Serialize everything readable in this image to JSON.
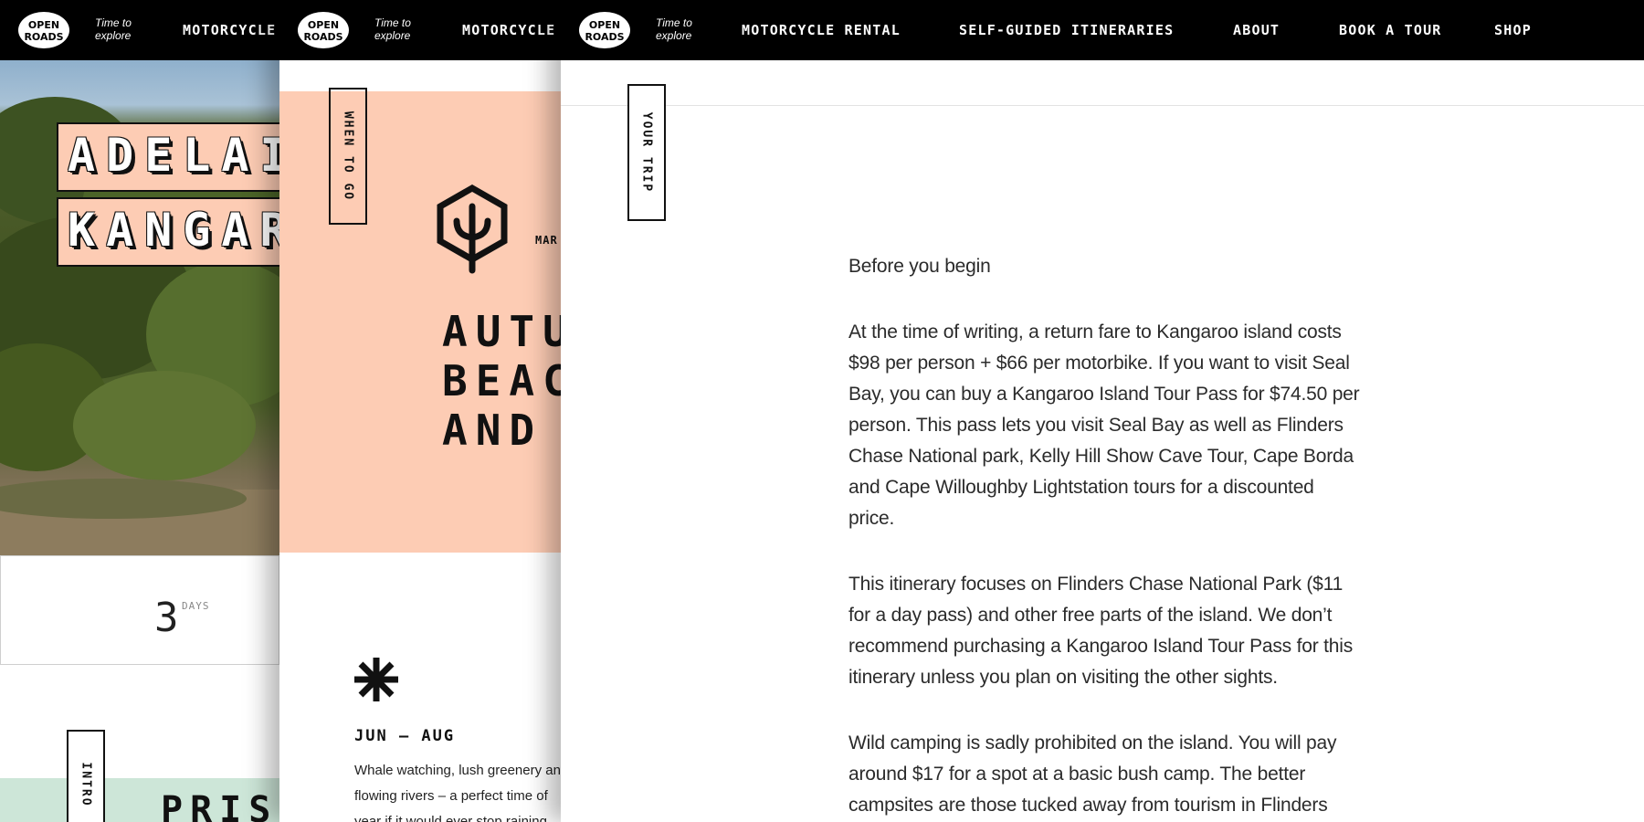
{
  "brand": {
    "logo_text": "OPEN ROADS",
    "tagline": "Time to explore"
  },
  "nav": {
    "truncated_item": "MOTORCYCLE",
    "items": [
      "MOTORCYCLE RENTAL",
      "SELF-GUIDED ITINERARIES",
      "ABOUT",
      "BOOK A TOUR",
      "SHOP"
    ]
  },
  "panel1": {
    "title_line_1": "ADELAI",
    "title_line_2": "KANGAR",
    "days_value": "3",
    "days_unit": "DAYS",
    "section_tab": "INTRO",
    "section_heading": "PRIST"
  },
  "panel2": {
    "section_tab": "WHEN TO GO",
    "months_label": "MAR",
    "season_title_lines": [
      "AUTU",
      "BEAC",
      "AND"
    ],
    "winter_months": "JUN – AUG",
    "winter_text": "Whale watching, lush greenery and flowing rivers – a perfect time of year if it would ever stop raining."
  },
  "panel3": {
    "section_tab": "YOUR TRIP",
    "paragraphs": [
      "Before you begin",
      "At the time of writing, a return fare to Kangaroo island costs $98 per person + $66 per motorbike. If you want to visit Seal Bay, you can buy a Kangaroo Island Tour Pass for $74.50 per person. This pass lets you visit Seal Bay as well as Flinders Chase National park, Kelly Hill Show Cave Tour, Cape Borda and Cape Willoughby Lightstation tours for a discounted price.",
      "This itinerary focuses on Flinders Chase National Park ($11 for a day pass) and other free parts of the island. We don’t recommend purchasing a Kangaroo Island Tour Pass for this itinerary unless you plan on visiting the other sights.",
      "Wild camping is sadly prohibited on the island. You will pay around $17 for a spot at a basic bush camp. The better campsites are those tucked away from tourism in Flinders"
    ]
  },
  "colors": {
    "navbar": "#000000",
    "peach": "#fdccb4",
    "mint": "#cde6d8",
    "text": "#2b2b2b"
  },
  "icons": [
    "open-roads-logo",
    "tree-icon",
    "asterisk-icon"
  ]
}
